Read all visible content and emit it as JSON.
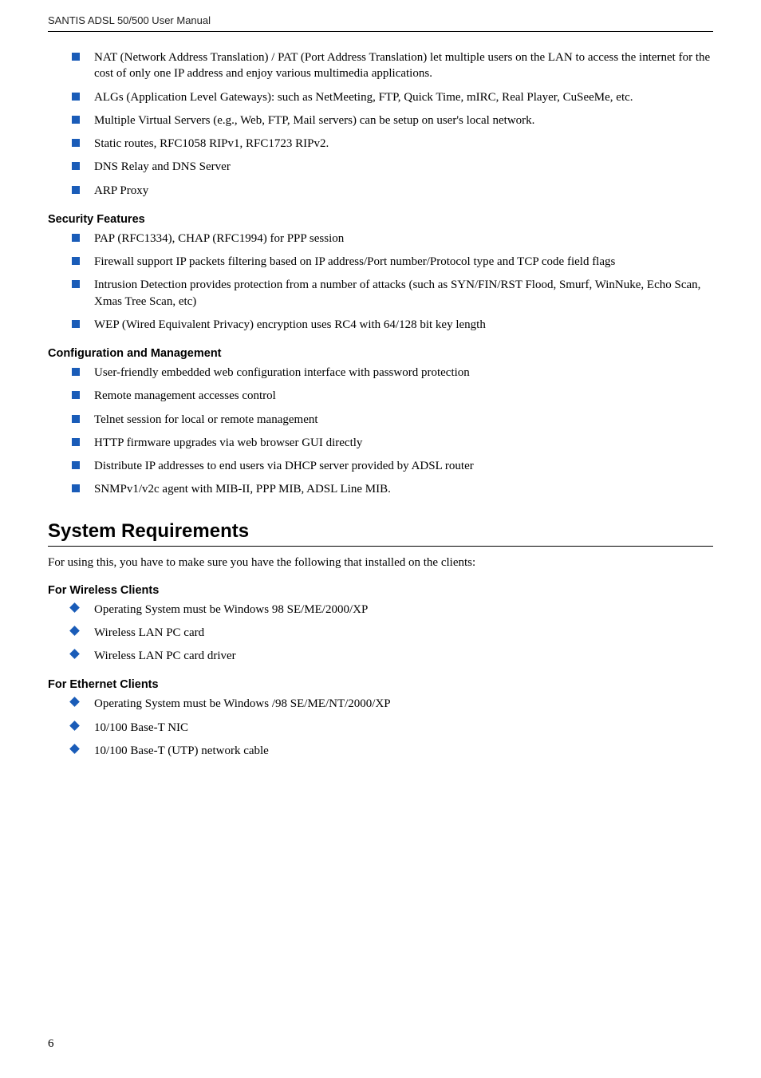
{
  "header": "SANTIS ADSL 50/500 User Manual",
  "pageNumber": "6",
  "topList": {
    "items": [
      "NAT (Network Address Translation) / PAT (Port Address Translation) let multiple users on the LAN to access the internet for the cost of only one IP address and enjoy various multimedia applications.",
      "ALGs (Application Level Gateways): such as NetMeeting, FTP, Quick Time, mIRC, Real Player, CuSeeMe, etc.",
      "Multiple Virtual Servers (e.g., Web, FTP, Mail servers) can be setup on user's local network.",
      "Static routes, RFC1058 RIPv1, RFC1723 RIPv2.",
      "DNS Relay and DNS Server",
      "ARP Proxy"
    ]
  },
  "securitySection": {
    "heading": "Security Features",
    "items": [
      "PAP (RFC1334), CHAP (RFC1994) for PPP session",
      "Firewall support IP packets filtering based on IP address/Port number/Protocol type and TCP code field flags",
      "Intrusion Detection provides protection from a number of attacks (such as SYN/FIN/RST Flood, Smurf, WinNuke, Echo Scan, Xmas Tree Scan, etc)",
      "WEP (Wired Equivalent Privacy) encryption uses RC4 with 64/128 bit key length"
    ]
  },
  "configSection": {
    "heading": "Configuration and Management",
    "items": [
      "User-friendly embedded web configuration interface with password protection",
      "Remote management accesses control",
      "Telnet session for local or remote management",
      "HTTP firmware upgrades via web browser GUI directly",
      "Distribute IP addresses to end users via DHCP server provided by ADSL router",
      "SNMPv1/v2c agent with MIB-II, PPP MIB, ADSL Line MIB."
    ]
  },
  "systemReq": {
    "heading": "System Requirements",
    "intro": "For using this, you have to make sure you have the following that installed on the clients:"
  },
  "wirelessSection": {
    "heading": "For Wireless Clients",
    "items": [
      "Operating System must be Windows 98 SE/ME/2000/XP",
      "Wireless LAN PC card",
      "Wireless LAN PC card driver"
    ]
  },
  "ethernetSection": {
    "heading": "For Ethernet Clients",
    "items": [
      "Operating System must be Windows /98 SE/ME/NT/2000/XP",
      "10/100 Base-T NIC",
      "10/100 Base-T (UTP) network cable"
    ]
  }
}
